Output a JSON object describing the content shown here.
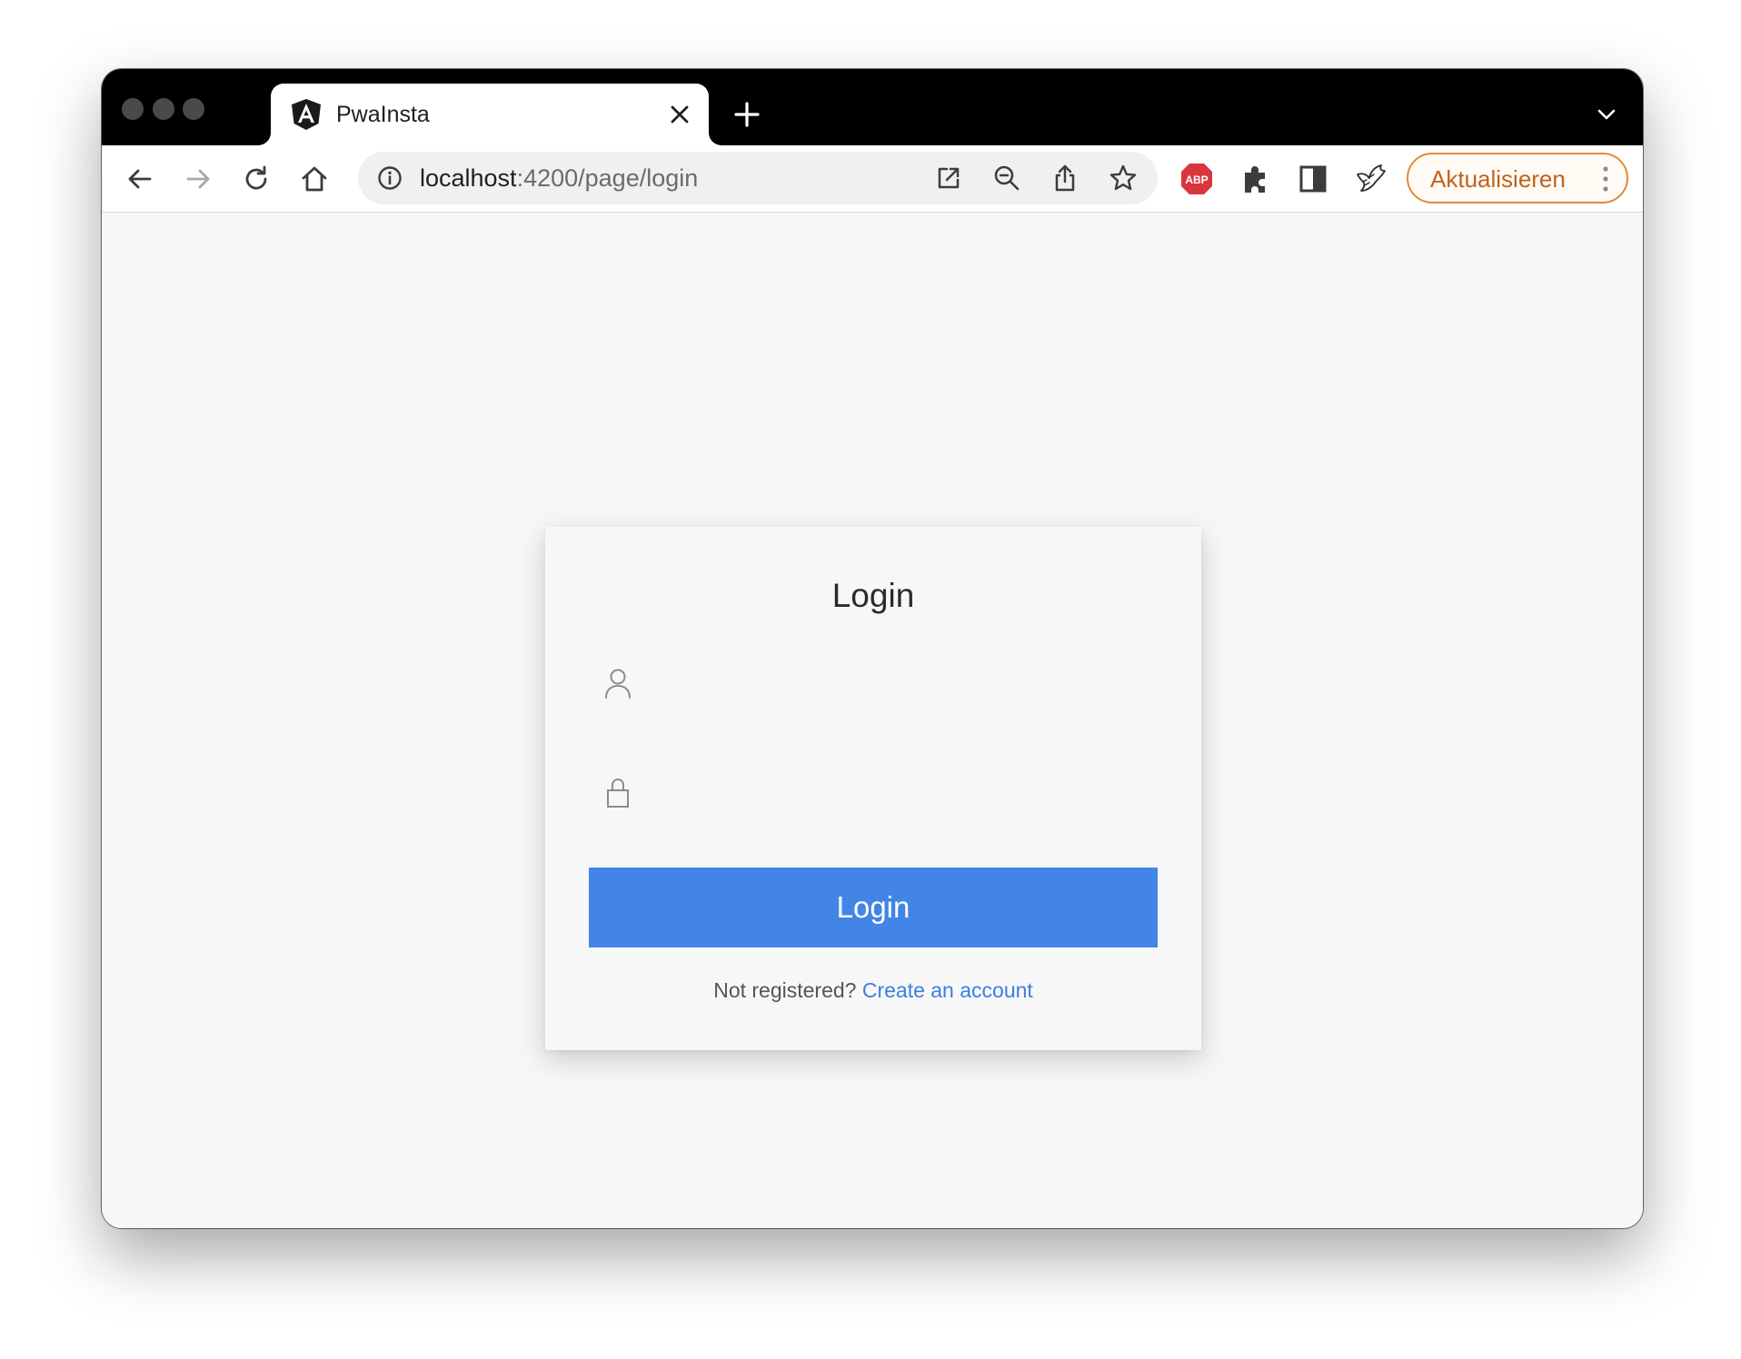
{
  "browser": {
    "tab": {
      "title": "PwaInsta",
      "favicon": "angular-icon"
    },
    "address_bar": {
      "host": "localhost",
      "path": ":4200/page/login"
    },
    "update_button": {
      "label": "Aktualisieren"
    },
    "icons": {
      "back": "arrow-left-icon",
      "forward": "arrow-right-icon",
      "reload": "reload-icon",
      "home": "home-icon",
      "site_info": "info-icon",
      "open_in_app": "open-external-icon",
      "zoom": "zoom-out-icon",
      "share": "share-icon",
      "bookmark": "star-icon",
      "adblock": "abp-icon",
      "extensions": "puzzle-icon",
      "side_panel": "side-panel-icon",
      "bird_extension": "bird-icon"
    },
    "colors": {
      "update_border": "#e08b3e",
      "update_text": "#c0631b",
      "adblock_red": "#d9363e"
    }
  },
  "login_card": {
    "title": "Login",
    "username_field": {
      "value": "",
      "placeholder": "",
      "icon": "user-icon"
    },
    "password_field": {
      "value": "",
      "placeholder": "",
      "icon": "lock-icon"
    },
    "submit_label": "Login",
    "register_prompt": "Not registered?",
    "register_link": "Create an account",
    "colors": {
      "button": "#4285e7",
      "link": "#3a7fe0"
    }
  }
}
